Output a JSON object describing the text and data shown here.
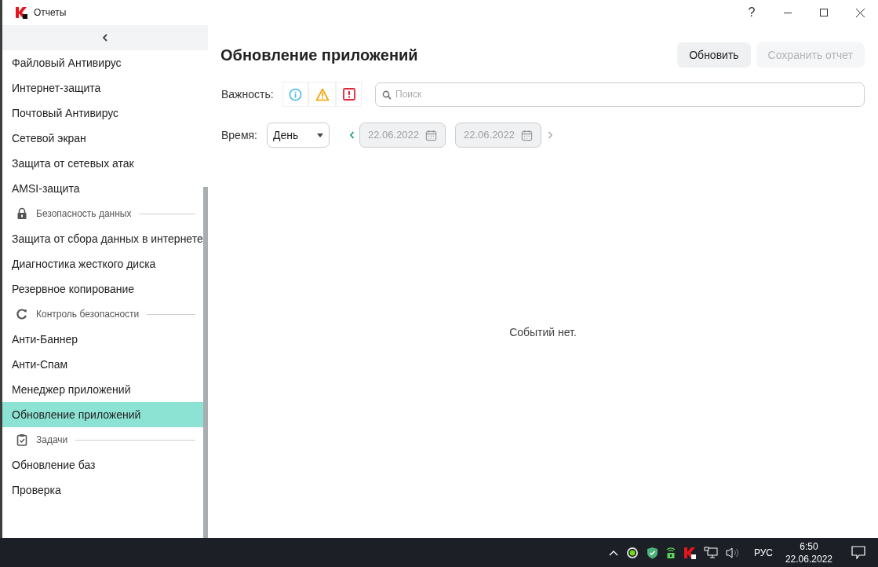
{
  "window": {
    "title": "Отчеты",
    "help": "?"
  },
  "sidebar": {
    "items": [
      {
        "kind": "item",
        "label": "Файловый Антивирус",
        "selected": false
      },
      {
        "kind": "item",
        "label": "Интернет-защита",
        "selected": false
      },
      {
        "kind": "item",
        "label": "Почтовый Антивирус",
        "selected": false
      },
      {
        "kind": "item",
        "label": "Сетевой экран",
        "selected": false
      },
      {
        "kind": "item",
        "label": "Защита от сетевых атак",
        "selected": false
      },
      {
        "kind": "item",
        "label": "AMSI-защита",
        "selected": false
      },
      {
        "kind": "section",
        "label": "Безопасность данных"
      },
      {
        "kind": "item",
        "label": "Защита от сбора данных в интернете",
        "selected": false
      },
      {
        "kind": "item",
        "label": "Диагностика жесткого диска",
        "selected": false
      },
      {
        "kind": "item",
        "label": "Резервное копирование",
        "selected": false
      },
      {
        "kind": "section",
        "label": "Контроль безопасности"
      },
      {
        "kind": "item",
        "label": "Анти-Баннер",
        "selected": false
      },
      {
        "kind": "item",
        "label": "Анти-Спам",
        "selected": false
      },
      {
        "kind": "item",
        "label": "Менеджер приложений",
        "selected": false
      },
      {
        "kind": "item",
        "label": "Обновление приложений",
        "selected": true
      },
      {
        "kind": "section",
        "label": "Задачи"
      },
      {
        "kind": "item",
        "label": "Обновление баз",
        "selected": false
      },
      {
        "kind": "item",
        "label": "Проверка",
        "selected": false
      }
    ]
  },
  "main": {
    "title": "Обновление приложений",
    "buttons": [
      {
        "label": "Обновить",
        "disabled": false
      },
      {
        "label": "Сохранить отчет",
        "disabled": true
      }
    ],
    "severity_label": "Важность:",
    "search": {
      "placeholder": "Поиск"
    },
    "time_label": "Время:",
    "period": "День",
    "date_from": "22.06.2022",
    "date_to": "22.06.2022",
    "empty_message": "Событий нет."
  },
  "taskbar": {
    "language": "РУС",
    "time": "6:50",
    "date": "22.06.2022"
  }
}
